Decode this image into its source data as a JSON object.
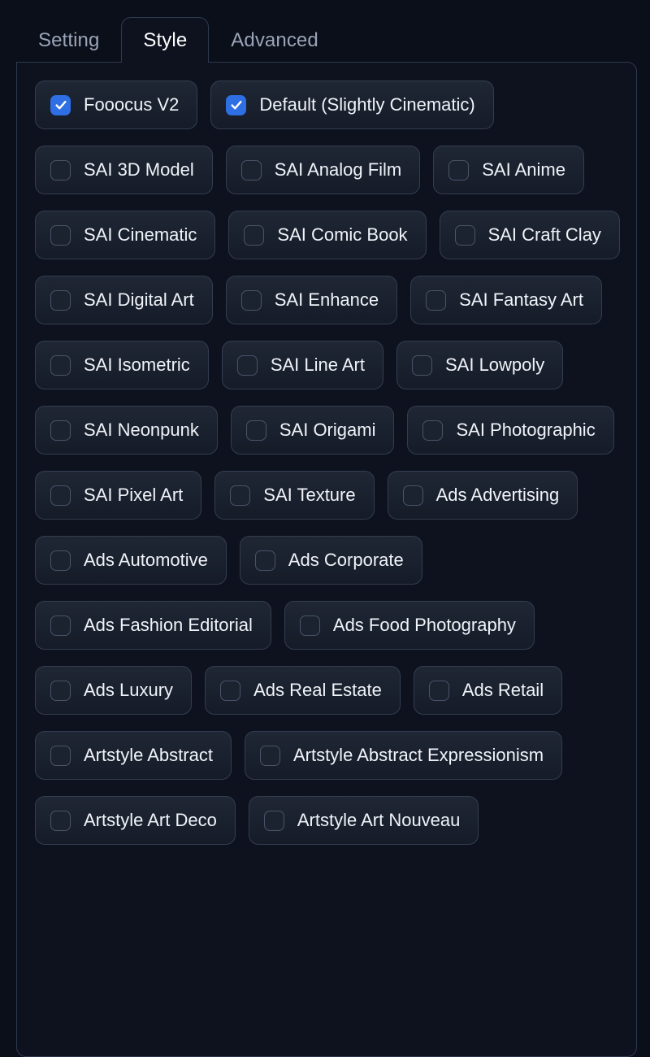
{
  "tabs": [
    {
      "label": "Setting",
      "active": false
    },
    {
      "label": "Style",
      "active": true
    },
    {
      "label": "Advanced",
      "active": false
    }
  ],
  "colors": {
    "page_background": "#0b0f1a",
    "panel_background": "#0d121e",
    "panel_border": "#2f3a4f",
    "chip_border": "#343d50",
    "chip_background_top": "#1f2634",
    "chip_background_bottom": "#151b27",
    "checkbox_checked": "#2f6fe4",
    "checkbox_border": "#4a5468",
    "label_text": "#f0f3f8",
    "tab_inactive_text": "#9aa4b8",
    "tab_active_text": "#ffffff"
  },
  "styles": [
    {
      "label": "Fooocus V2",
      "checked": true
    },
    {
      "label": "Default (Slightly Cinematic)",
      "checked": true
    },
    {
      "label": "SAI 3D Model",
      "checked": false
    },
    {
      "label": "SAI Analog Film",
      "checked": false
    },
    {
      "label": "SAI Anime",
      "checked": false
    },
    {
      "label": "SAI Cinematic",
      "checked": false
    },
    {
      "label": "SAI Comic Book",
      "checked": false
    },
    {
      "label": "SAI Craft Clay",
      "checked": false
    },
    {
      "label": "SAI Digital Art",
      "checked": false
    },
    {
      "label": "SAI Enhance",
      "checked": false
    },
    {
      "label": "SAI Fantasy Art",
      "checked": false
    },
    {
      "label": "SAI Isometric",
      "checked": false
    },
    {
      "label": "SAI Line Art",
      "checked": false
    },
    {
      "label": "SAI Lowpoly",
      "checked": false
    },
    {
      "label": "SAI Neonpunk",
      "checked": false
    },
    {
      "label": "SAI Origami",
      "checked": false
    },
    {
      "label": "SAI Photographic",
      "checked": false
    },
    {
      "label": "SAI Pixel Art",
      "checked": false
    },
    {
      "label": "SAI Texture",
      "checked": false
    },
    {
      "label": "Ads Advertising",
      "checked": false
    },
    {
      "label": "Ads Automotive",
      "checked": false
    },
    {
      "label": "Ads Corporate",
      "checked": false
    },
    {
      "label": "Ads Fashion Editorial",
      "checked": false
    },
    {
      "label": "Ads Food Photography",
      "checked": false
    },
    {
      "label": "Ads Luxury",
      "checked": false
    },
    {
      "label": "Ads Real Estate",
      "checked": false
    },
    {
      "label": "Ads Retail",
      "checked": false
    },
    {
      "label": "Artstyle Abstract",
      "checked": false
    },
    {
      "label": "Artstyle Abstract Expressionism",
      "checked": false
    },
    {
      "label": "Artstyle Art Deco",
      "checked": false
    },
    {
      "label": "Artstyle Art Nouveau",
      "checked": false
    }
  ]
}
